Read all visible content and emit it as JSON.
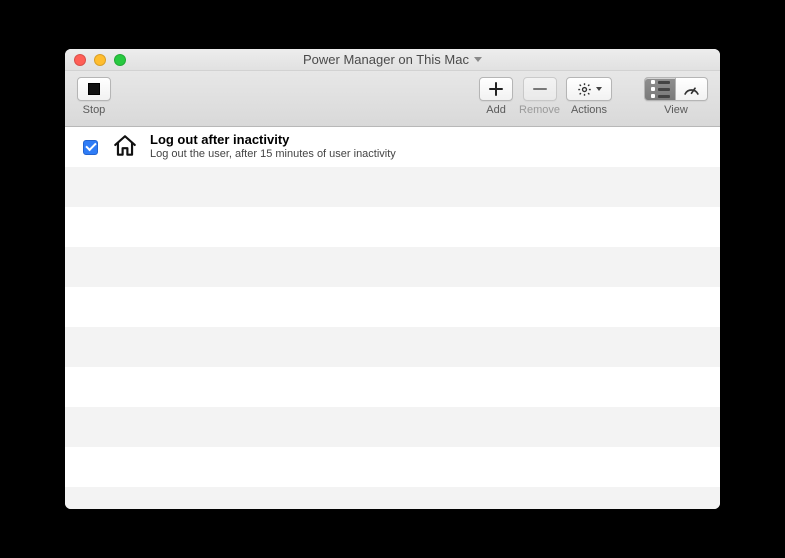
{
  "window": {
    "title": "Power Manager on This Mac"
  },
  "toolbar": {
    "stop_label": "Stop",
    "add_label": "Add",
    "remove_label": "Remove",
    "actions_label": "Actions",
    "view_label": "View"
  },
  "events": [
    {
      "enabled": true,
      "icon": "house-icon",
      "title": "Log out after inactivity",
      "subtitle": "Log out the user, after 15 minutes of user inactivity"
    }
  ]
}
